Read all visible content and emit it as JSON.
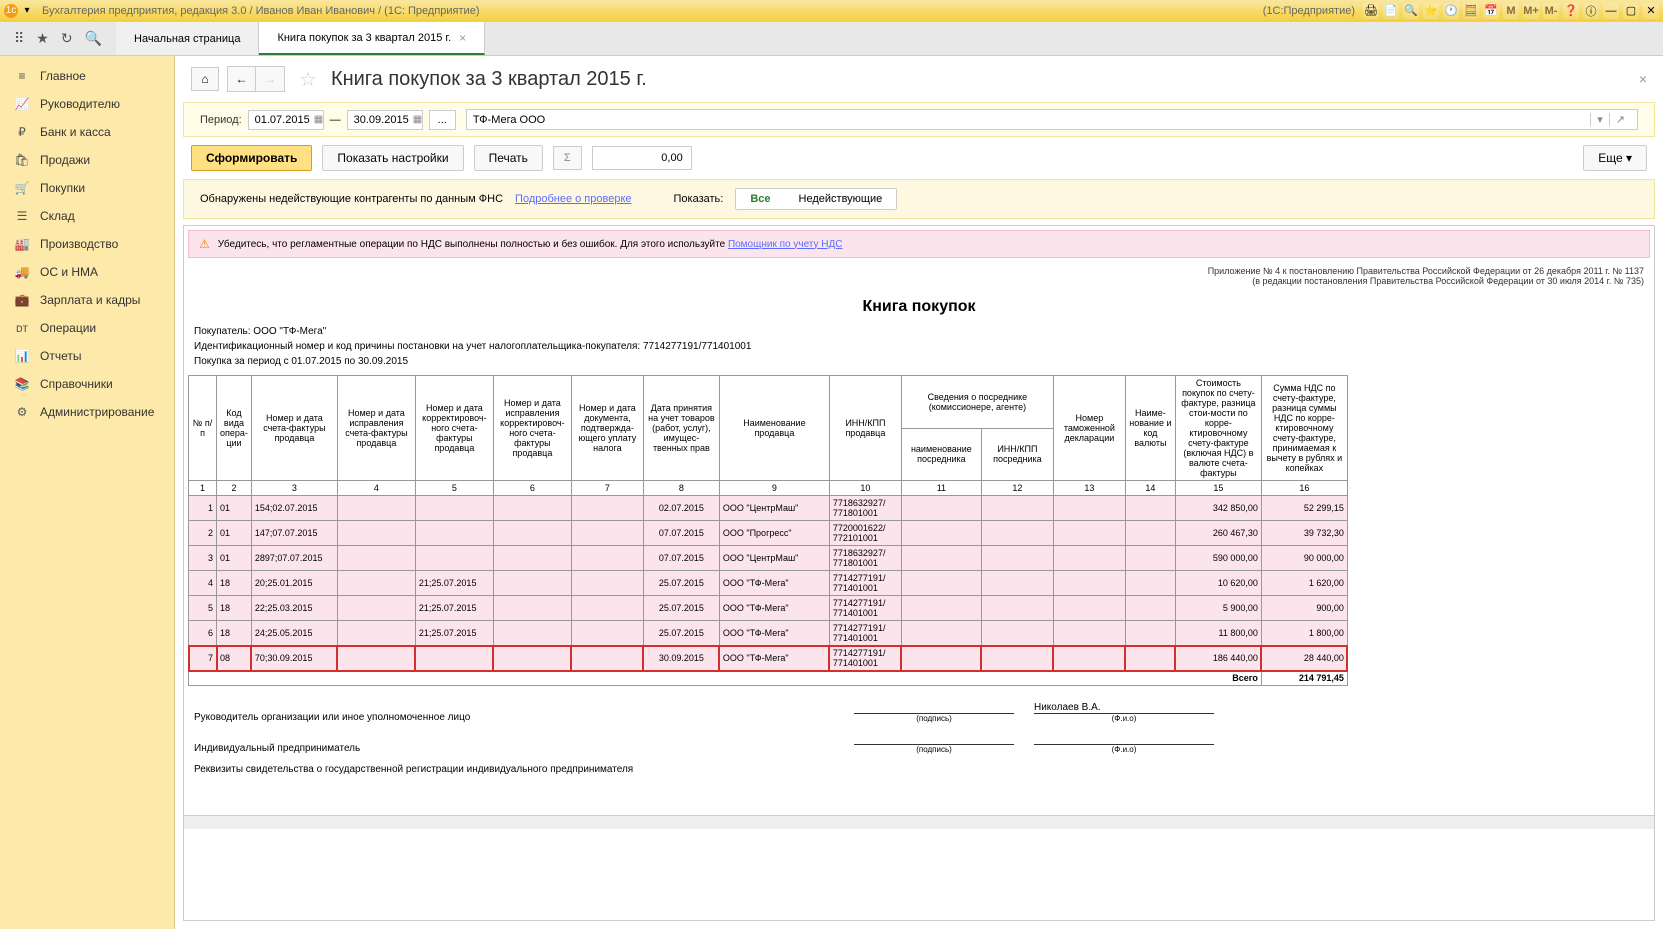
{
  "titlebar": {
    "title": "Бухгалтерия предприятия, редакция 3.0 / Иванов Иван Иванович / (1С: Предприятие)",
    "right": "(1С:Предприятие)"
  },
  "tabs": {
    "start": "Начальная страница",
    "active": "Книга покупок за 3 квартал 2015 г."
  },
  "sidebar": {
    "items": [
      {
        "icon": "≡",
        "label": "Главное"
      },
      {
        "icon": "📈",
        "label": "Руководителю"
      },
      {
        "icon": "₽",
        "label": "Банк и касса"
      },
      {
        "icon": "🛍",
        "label": "Продажи"
      },
      {
        "icon": "🛒",
        "label": "Покупки"
      },
      {
        "icon": "☰",
        "label": "Склад"
      },
      {
        "icon": "🏭",
        "label": "Производство"
      },
      {
        "icon": "🚚",
        "label": "ОС и НМА"
      },
      {
        "icon": "💼",
        "label": "Зарплата и кадры"
      },
      {
        "icon": "ᴅᴛ",
        "label": "Операции"
      },
      {
        "icon": "📊",
        "label": "Отчеты"
      },
      {
        "icon": "📚",
        "label": "Справочники"
      },
      {
        "icon": "⚙",
        "label": "Администрирование"
      }
    ]
  },
  "page": {
    "title": "Книга покупок за 3 квартал 2015 г.",
    "period_label": "Период:",
    "date_from": "01.07.2015",
    "dash": "—",
    "date_to": "30.09.2015",
    "dots": "...",
    "org": "ТФ-Мега ООО",
    "btn_form": "Сформировать",
    "btn_settings": "Показать настройки",
    "btn_print": "Печать",
    "sigma": "Σ",
    "num_value": "0,00",
    "btn_more": "Еще",
    "info_text": "Обнаружены недействующие контрагенты по данным ФНС",
    "info_link": "Подробнее о проверке",
    "show_label": "Показать:",
    "toggle_all": "Все",
    "toggle_bad": "Недействующие",
    "close_x": "×"
  },
  "report": {
    "warn_text": "Убедитесь, что регламентные операции по НДС выполнены полностью и без ошибок. Для этого используйте ",
    "warn_link": "Помощник по учету НДС",
    "note1": "Приложение № 4 к постановлению Правительства Российской Федерации от 26 декабря 2011 г. № 1137",
    "note2": "(в редакции постановления Правительства Российской Федерации от 30 июля 2014 г. № 735)",
    "title": "Книга покупок",
    "buyer": "Покупатель:  ООО \"ТФ-Мега\"",
    "inn": "Идентификационный номер и код причины постановки на учет налогоплательщика-покупателя:  7714277191/771401001",
    "period": "Покупка за период с 01.07.2015 по 30.09.2015",
    "headers": {
      "h1": "№ п/п",
      "h2": "Код вида опера-ции",
      "h3": "Номер и дата счета-фактуры продавца",
      "h4": "Номер и дата исправления счета-фактуры продавца",
      "h5": "Номер и дата корректировоч-ного счета-фактуры продавца",
      "h6": "Номер и дата исправления корректировоч-ного счета-фактуры продавца",
      "h7": "Номер и дата документа, подтвержда-ющего уплату налога",
      "h8": "Дата принятия на учет товаров (работ, услуг), имущес-твенных прав",
      "h9": "Наименование продавца",
      "h10": "ИНН/КПП продавца",
      "h11": "Сведения о посреднике (комиссионере, агенте)",
      "h11a": "наименование посредника",
      "h11b": "ИНН/КПП посредника",
      "h13": "Номер таможенной декларации",
      "h14": "Наиме-нование и код валюты",
      "h15": "Стоимость покупок по счету-фактуре, разница стои-мости по корре-ктировочному счету-фактуре (включая НДС) в валюте счета-фактуры",
      "h16": "Сумма НДС по счету-фактуре, разница суммы НДС по корре-ктировочному счету-фактуре, принимаемая к вычету в рублях и копейках"
    },
    "rows": [
      {
        "n": "1",
        "code": "01",
        "inv": "154;02.07.2015",
        "c4": "",
        "c5": "",
        "c6": "",
        "c7": "",
        "date": "02.07.2015",
        "seller": "ООО \"ЦентрМаш\"",
        "inn": "7718632927/ 771801001",
        "c11": "",
        "c12": "",
        "c13": "",
        "c14": "",
        "cost": "342 850,00",
        "vat": "52 299,15"
      },
      {
        "n": "2",
        "code": "01",
        "inv": "147;07.07.2015",
        "c4": "",
        "c5": "",
        "c6": "",
        "c7": "",
        "date": "07.07.2015",
        "seller": "ООО \"Прогресс\"",
        "inn": "7720001622/ 772101001",
        "c11": "",
        "c12": "",
        "c13": "",
        "c14": "",
        "cost": "260 467,30",
        "vat": "39 732,30"
      },
      {
        "n": "3",
        "code": "01",
        "inv": "2897;07.07.2015",
        "c4": "",
        "c5": "",
        "c6": "",
        "c7": "",
        "date": "07.07.2015",
        "seller": "ООО \"ЦентрМаш\"",
        "inn": "7718632927/ 771801001",
        "c11": "",
        "c12": "",
        "c13": "",
        "c14": "",
        "cost": "590 000,00",
        "vat": "90 000,00"
      },
      {
        "n": "4",
        "code": "18",
        "inv": "20;25.01.2015",
        "c4": "",
        "c5": "21;25.07.2015",
        "c6": "",
        "c7": "",
        "date": "25.07.2015",
        "seller": "ООО \"ТФ-Мега\"",
        "inn": "7714277191/ 771401001",
        "c11": "",
        "c12": "",
        "c13": "",
        "c14": "",
        "cost": "10 620,00",
        "vat": "1 620,00"
      },
      {
        "n": "5",
        "code": "18",
        "inv": "22;25.03.2015",
        "c4": "",
        "c5": "21;25.07.2015",
        "c6": "",
        "c7": "",
        "date": "25.07.2015",
        "seller": "ООО \"ТФ-Мега\"",
        "inn": "7714277191/ 771401001",
        "c11": "",
        "c12": "",
        "c13": "",
        "c14": "",
        "cost": "5 900,00",
        "vat": "900,00"
      },
      {
        "n": "6",
        "code": "18",
        "inv": "24;25.05.2015",
        "c4": "",
        "c5": "21;25.07.2015",
        "c6": "",
        "c7": "",
        "date": "25.07.2015",
        "seller": "ООО \"ТФ-Мега\"",
        "inn": "7714277191/ 771401001",
        "c11": "",
        "c12": "",
        "c13": "",
        "c14": "",
        "cost": "11 800,00",
        "vat": "1 800,00"
      },
      {
        "n": "7",
        "code": "08",
        "inv": "70;30.09.2015",
        "c4": "",
        "c5": "",
        "c6": "",
        "c7": "",
        "date": "30.09.2015",
        "seller": "ООО \"ТФ-Мега\"",
        "inn": "7714277191/ 771401001",
        "c11": "",
        "c12": "",
        "c13": "",
        "c14": "",
        "cost": "186 440,00",
        "vat": "28 440,00",
        "hl": true
      }
    ],
    "total_label": "Всего",
    "total_value": "214 791,45",
    "sig": {
      "l1": "Руководитель организации или иное уполномоченное лицо",
      "l2": "Индивидуальный предприниматель",
      "l3": "Реквизиты свидетельства о государственной регистрации индивидуального предпринимателя",
      "name": "Николаев В.А.",
      "podpis": "(подпись)",
      "fio": "(Ф.и.о)"
    }
  }
}
